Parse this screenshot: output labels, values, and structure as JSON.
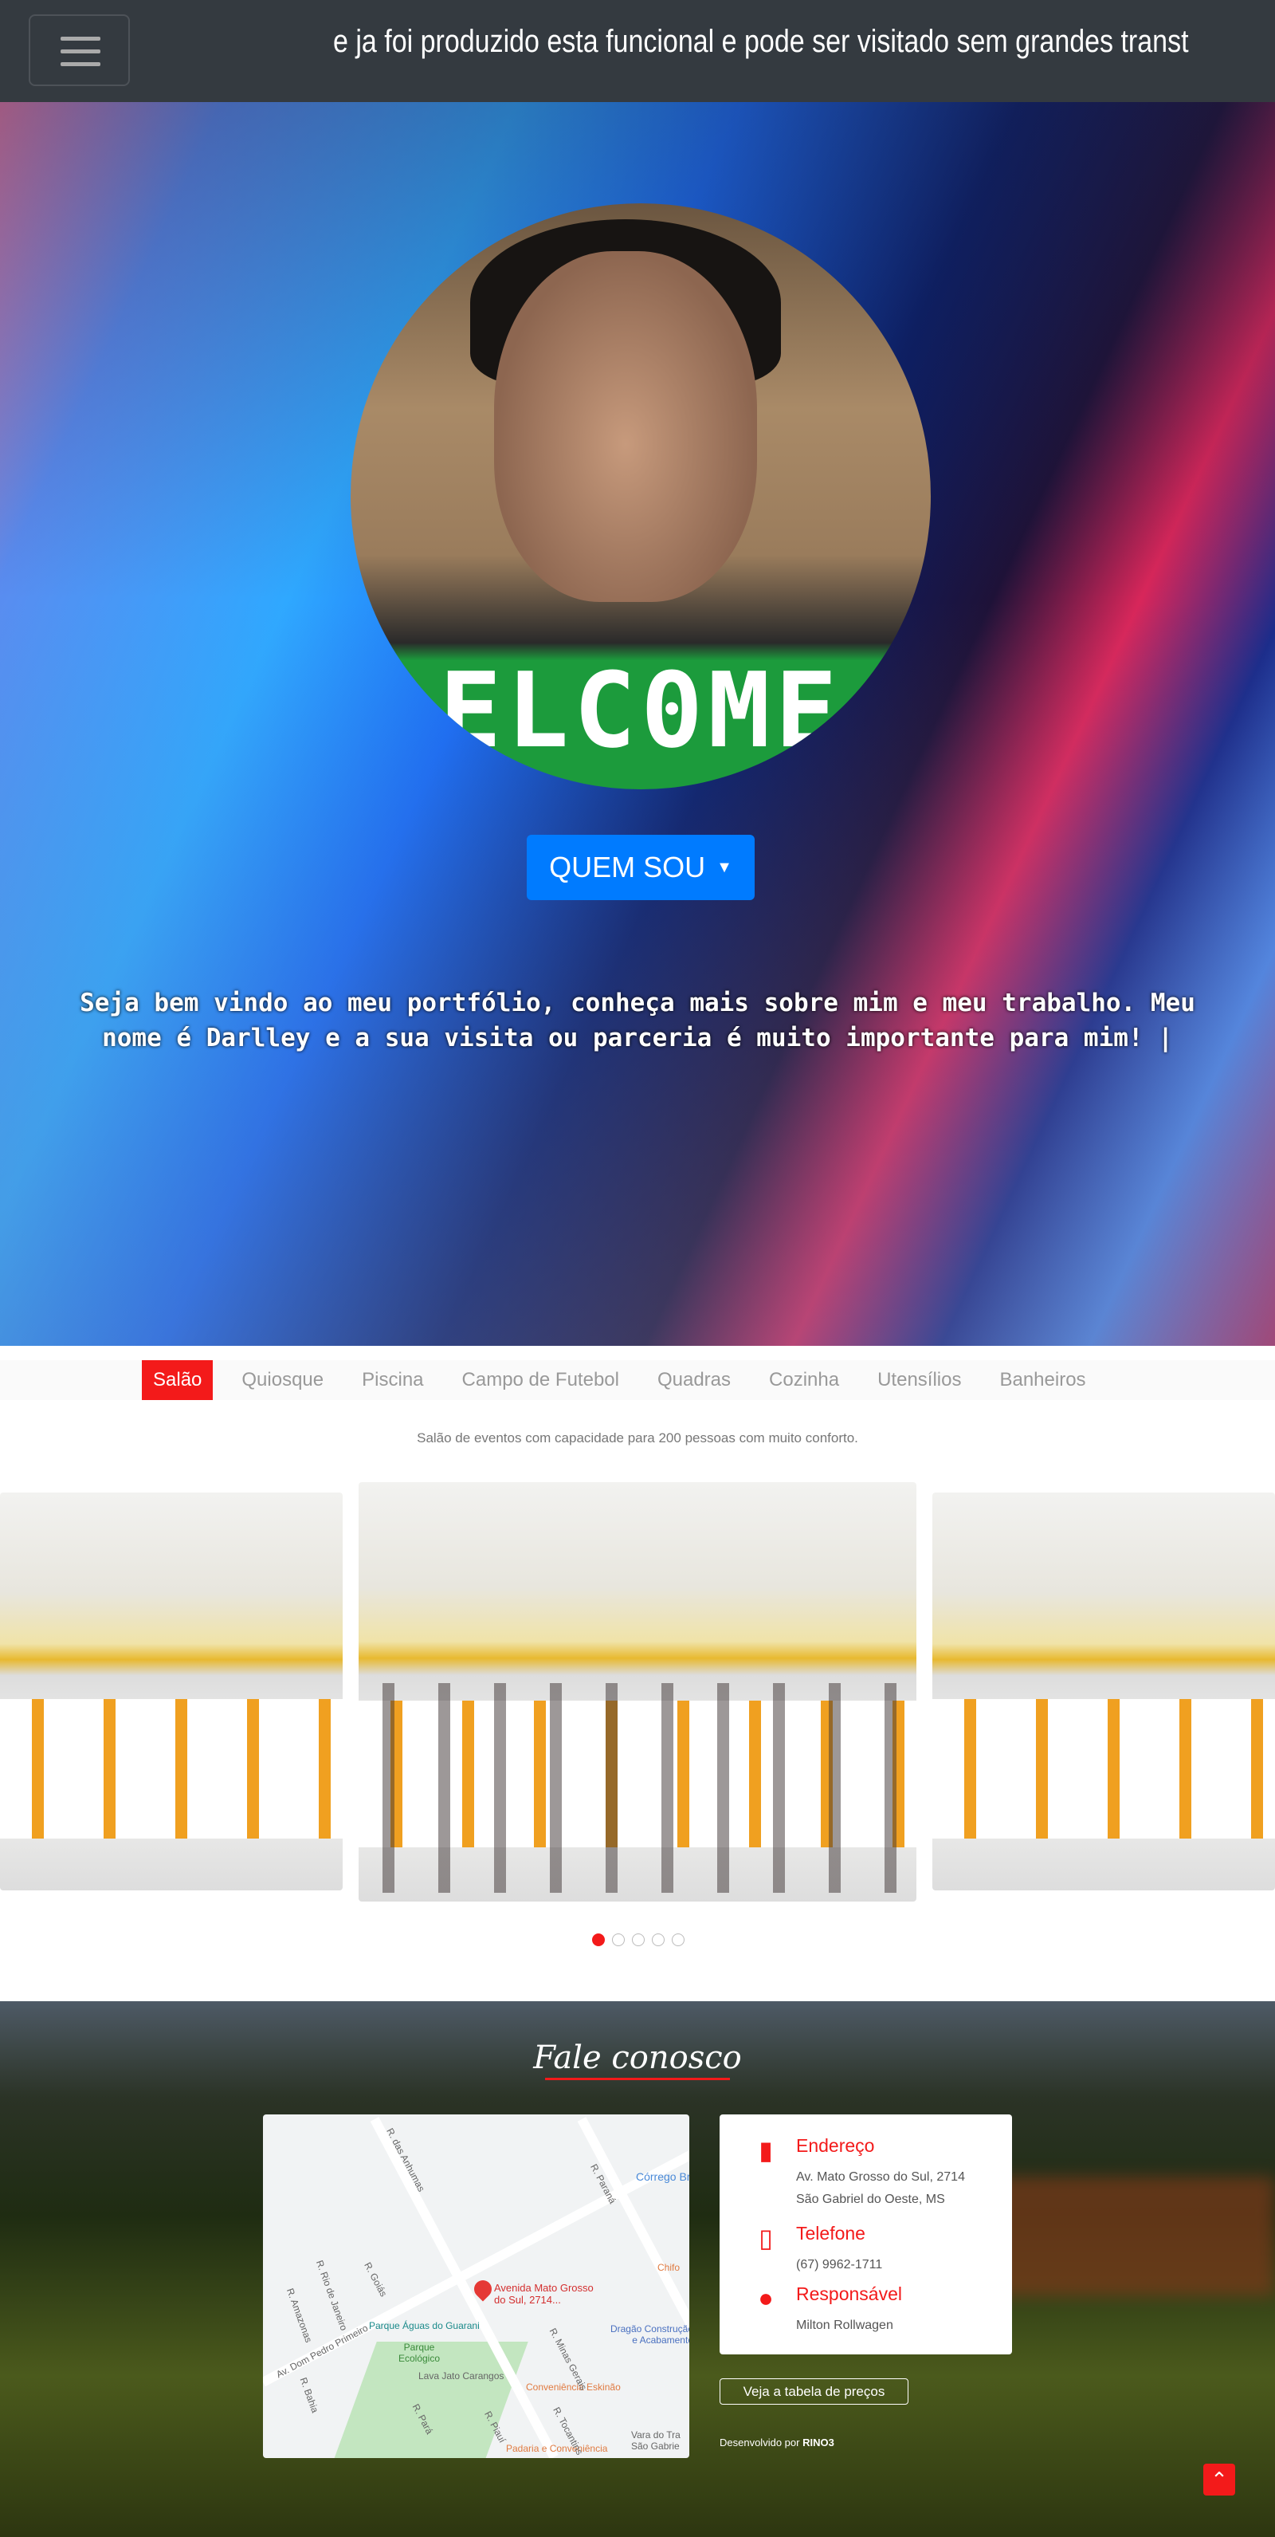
{
  "nav": {
    "marquee": "e ja foi produzido esta funcional e pode ser visitado sem grandes transt"
  },
  "hero": {
    "avatar_text": "ELC0ME",
    "button_label": "QUEM SOU",
    "intro": "Seja bem vindo ao meu portfólio, conheça mais sobre mim e meu trabalho. Meu nome é Darlley e a sua visita ou parceria é muito importante para mim! |"
  },
  "tabs": [
    "Salão",
    "Quiosque",
    "Piscina",
    "Campo de Futebol",
    "Quadras",
    "Cozinha",
    "Utensílios",
    "Banheiros"
  ],
  "caption": "Salão de eventos com capacidade para 200 pessoas com muito conforto.",
  "carousel": {
    "slides": 5,
    "active": 0
  },
  "contact": {
    "title": "Fale conosco",
    "map": {
      "pin_label": "Avenida Mato Grosso do Sul, 2714...",
      "labels": [
        "R. das Anhumas",
        "R. Paraná",
        "Córrego Br",
        "Parque Águas do Guarani",
        "Parque Ecológico",
        "Lava Jato Carangos",
        "Conveniência Eskinão",
        "Padaria e Conveniência",
        "Dragão Construção e Acabamento",
        "R. Minas Gerais",
        "R. Tocantins",
        "Av. Dom Pedro Primeiro",
        "R. Goiás",
        "R. Pará",
        "R. Rio de Janeiro",
        "R. Amazonas",
        "R. Bahia",
        "R. Piauí",
        "Vara do Tra São Gabrie",
        "Chifo"
      ]
    },
    "address_title": "Endereço",
    "address_line1": "Av. Mato Grosso do Sul, 2714",
    "address_line2": "São Gabriel do Oeste, MS",
    "phone_title": "Telefone",
    "phone": "(67) 9962-1711",
    "resp_title": "Responsável",
    "resp": "Milton Rollwagen",
    "prices_button": "Veja a tabela de preços",
    "credit_prefix": "Desenvolvido por",
    "credit_brand": "RINO3"
  },
  "colors": {
    "accent": "#f31a1a",
    "primary": "#007bff",
    "nav": "#343a40"
  }
}
